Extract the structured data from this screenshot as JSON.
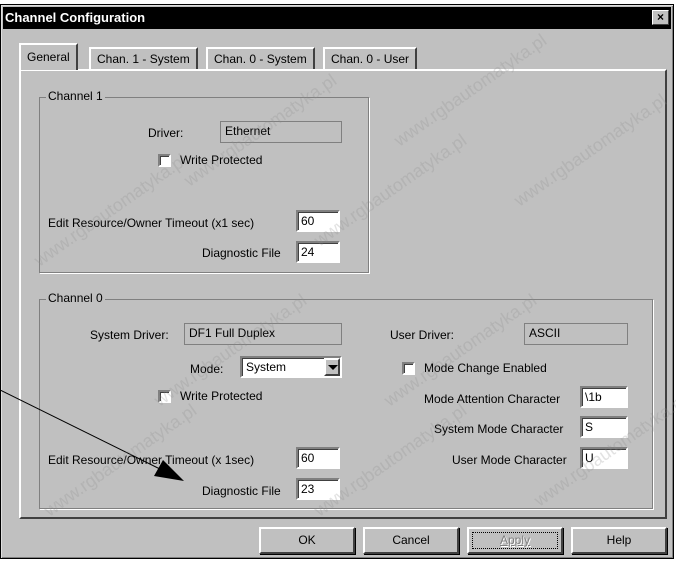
{
  "window": {
    "title": "Channel Configuration",
    "close_glyph": "×"
  },
  "tabs": [
    {
      "label": "General"
    },
    {
      "label": "Chan. 1 - System"
    },
    {
      "label": "Chan. 0 - System"
    },
    {
      "label": "Chan. 0 - User"
    }
  ],
  "channel1": {
    "group_label": "Channel 1",
    "driver_label": "Driver:",
    "driver_value": "Ethernet",
    "write_protected_label": "Write Protected",
    "timeout_label": "Edit Resource/Owner Timeout (x1 sec)",
    "timeout_value": "60",
    "diag_label": "Diagnostic File",
    "diag_value": "24"
  },
  "channel0": {
    "group_label": "Channel 0",
    "system_driver_label": "System Driver:",
    "system_driver_value": "DF1 Full Duplex",
    "user_driver_label": "User Driver:",
    "user_driver_value": "ASCII",
    "mode_label": "Mode:",
    "mode_value": "System",
    "mode_change_label": "Mode Change Enabled",
    "write_protected_label": "Write Protected",
    "attention_label": "Mode Attention Character",
    "attention_value": "\\1b",
    "system_mode_label": "System Mode Character",
    "system_mode_value": "S",
    "user_mode_label": "User Mode Character",
    "user_mode_value": "U",
    "timeout_label": "Edit Resource/Owner Timeout (x 1sec)",
    "timeout_value": "60",
    "diag_label": "Diagnostic File",
    "diag_value": "23"
  },
  "buttons": {
    "ok": "OK",
    "cancel": "Cancel",
    "apply": "Apply",
    "help": "Help"
  },
  "watermark_text": "www.rgbautomatyka.pl",
  "colors": {
    "face": "#c0c0c0",
    "titlebar": "#000000",
    "field": "#ffffff"
  }
}
